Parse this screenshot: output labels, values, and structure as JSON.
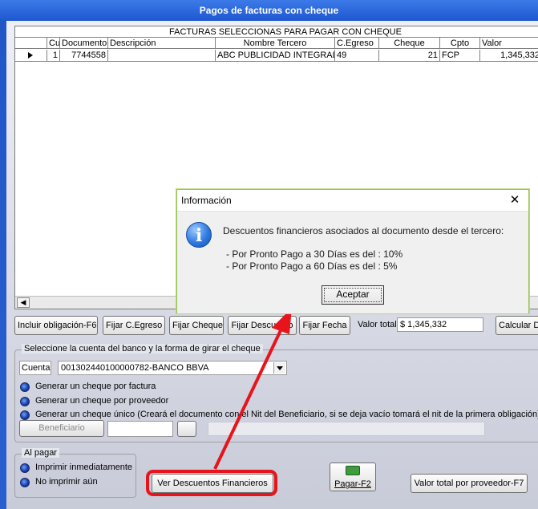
{
  "window": {
    "title": "Pagos de facturas con cheque"
  },
  "grid": {
    "caption": "FACTURAS SELECCIONAS PARA PAGAR CON CHEQUE",
    "headers": [
      "Cu",
      "Documento",
      "Descripción",
      "Nombre Tercero",
      "C.Egreso",
      "Cheque",
      "Cpto",
      "Valor"
    ],
    "rows": [
      [
        "1",
        "7744558",
        "",
        "ABC PUBLICIDAD INTEGRAL",
        "49",
        "21",
        "FCP",
        "1,345,332"
      ]
    ]
  },
  "toolbar": {
    "incluir": "Incluir obligación-F6",
    "fijar_egreso": "Fijar C.Egreso",
    "fijar_cheque": "Fijar Cheque",
    "fijar_descuento": "Fijar Descuento",
    "fijar_fecha": "Fijar Fecha",
    "valor_total_label": "Valor total",
    "valor_total_value": "$ 1,345,332",
    "calcular": "Calcular D"
  },
  "bank_group": {
    "title": "Seleccione la cuenta del banco y la forma de girar el cheque",
    "cuenta_label": "Cuenta",
    "cuenta_value": "001302440100000782-BANCO BBVA",
    "options": [
      "Generar un cheque por factura",
      "Generar un cheque por proveedor",
      "Generar un cheque único (Creará el documento con el Nit del Beneficiario, si se deja vacío tomará el nit de la primera obligación)"
    ],
    "beneficiario": "Beneficiario"
  },
  "pay_group": {
    "title": "Al pagar",
    "options": [
      "Imprimir inmediatamente",
      "No imprimir aún"
    ]
  },
  "bottom": {
    "ver_descuentos": "Ver Descuentos Financieros",
    "pagar": "Pagar-F2",
    "valor_proveedor": "Valor total por proveedor-F7"
  },
  "dialog": {
    "title": "Información",
    "message": "Descuentos financieros asociados al documento desde el tercero:",
    "line1": "- Por Pronto Pago a 30 Días es del : 10%",
    "line2": "- Por Pronto Pago a 60 Días es del : 5%",
    "accept": "Aceptar"
  },
  "colors": {
    "title_bar": "#2156c6",
    "annotation": "#e8141c"
  }
}
